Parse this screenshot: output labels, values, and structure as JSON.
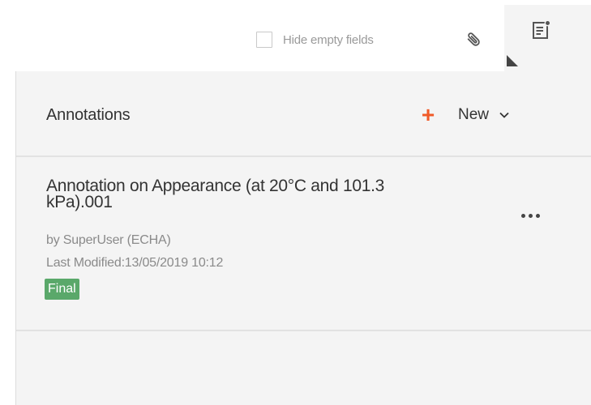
{
  "toolbar": {
    "hide_empty_label": "Hide empty fields",
    "hide_empty_checked": false,
    "attachment_icon": "paperclip-icon",
    "annotations_tab_icon": "annotation-note-icon"
  },
  "panel": {
    "title": "Annotations",
    "new_label": "New",
    "new_icon": "plus-icon",
    "dropdown_icon": "chevron-down-icon",
    "accent_color": "#f05a28"
  },
  "annotations": [
    {
      "title": "Annotation on Appearance (at 20°C and 101.3 kPa).001",
      "author": "by SuperUser (ECHA)",
      "last_modified": "Last Modified:13/05/2019 10:12",
      "status": "Final",
      "status_color": "#5aa86a",
      "menu_icon": "more-options-icon"
    }
  ]
}
